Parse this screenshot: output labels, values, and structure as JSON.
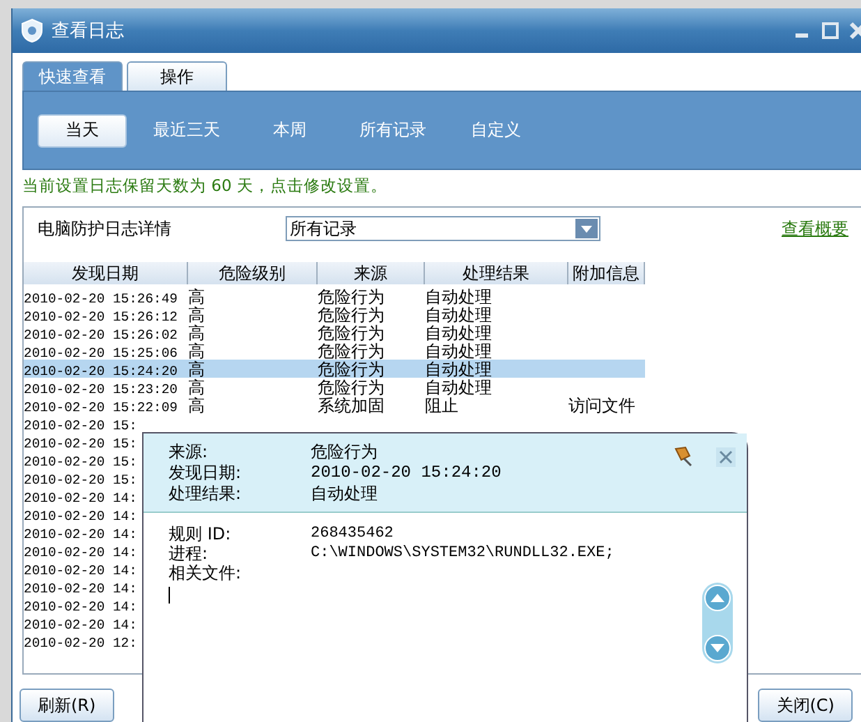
{
  "window": {
    "title": "查看日志"
  },
  "tabs": [
    {
      "label": "快速查看",
      "selected": true
    },
    {
      "label": "操作",
      "selected": false
    }
  ],
  "ranges": [
    {
      "label": "当天",
      "selected": true
    },
    {
      "label": "最近三天",
      "selected": false
    },
    {
      "label": "本周",
      "selected": false
    },
    {
      "label": "所有记录",
      "selected": false
    },
    {
      "label": "自定义",
      "selected": false
    }
  ],
  "retention_notice": "当前设置日志保留天数为 60 天，点击修改设置。",
  "log_section": {
    "title": "电脑防护日志详情",
    "filter": "所有记录",
    "summary_link": "查看概要"
  },
  "table": {
    "columns": [
      "发现日期",
      "危险级别",
      "来源",
      "处理结果",
      "附加信息"
    ],
    "rows": [
      {
        "cells": [
          "2010-02-20 15:26:49",
          "高",
          "危险行为",
          "自动处理",
          ""
        ],
        "selected": false
      },
      {
        "cells": [
          "2010-02-20 15:26:12",
          "高",
          "危险行为",
          "自动处理",
          ""
        ],
        "selected": false
      },
      {
        "cells": [
          "2010-02-20 15:26:02",
          "高",
          "危险行为",
          "自动处理",
          ""
        ],
        "selected": false
      },
      {
        "cells": [
          "2010-02-20 15:25:06",
          "高",
          "危险行为",
          "自动处理",
          ""
        ],
        "selected": false
      },
      {
        "cells": [
          "2010-02-20 15:24:20",
          "高",
          "危险行为",
          "自动处理",
          ""
        ],
        "selected": true
      },
      {
        "cells": [
          "2010-02-20 15:23:20",
          "高",
          "危险行为",
          "自动处理",
          ""
        ],
        "selected": false
      },
      {
        "cells": [
          "2010-02-20 15:22:09",
          "高",
          "系统加固",
          "阻止",
          "访问文件"
        ],
        "selected": false
      },
      {
        "cells": [
          "2010-02-20 15:"
        ],
        "selected": false
      },
      {
        "cells": [
          "2010-02-20 15:"
        ],
        "selected": false
      },
      {
        "cells": [
          "2010-02-20 15:"
        ],
        "selected": false
      },
      {
        "cells": [
          "2010-02-20 15:"
        ],
        "selected": false
      },
      {
        "cells": [
          "2010-02-20 14:"
        ],
        "selected": false
      },
      {
        "cells": [
          "2010-02-20 14:"
        ],
        "selected": false
      },
      {
        "cells": [
          "2010-02-20 14:"
        ],
        "selected": false
      },
      {
        "cells": [
          "2010-02-20 14:"
        ],
        "selected": false
      },
      {
        "cells": [
          "2010-02-20 14:"
        ],
        "selected": false
      },
      {
        "cells": [
          "2010-02-20 14:"
        ],
        "selected": false
      },
      {
        "cells": [
          "2010-02-20 14:"
        ],
        "selected": false
      },
      {
        "cells": [
          "2010-02-20 14:"
        ],
        "selected": false
      },
      {
        "cells": [
          "2010-02-20 12:"
        ],
        "selected": false
      }
    ]
  },
  "refresh_button": "刷新(R)",
  "close_button": "关闭(C)",
  "detail_popup": {
    "summary": [
      {
        "label": "来源:",
        "value": "危险行为"
      },
      {
        "label": "发现日期:",
        "value": "2010-02-20 15:24:20"
      },
      {
        "label": "处理结果:",
        "value": "自动处理"
      }
    ],
    "details": [
      {
        "label": "规则 ID:",
        "value": "268435462"
      },
      {
        "label": "进程:",
        "value": "C:\\WINDOWS\\SYSTEM32\\RUNDLL32.EXE;"
      },
      {
        "label": "相关文件:"
      }
    ]
  }
}
